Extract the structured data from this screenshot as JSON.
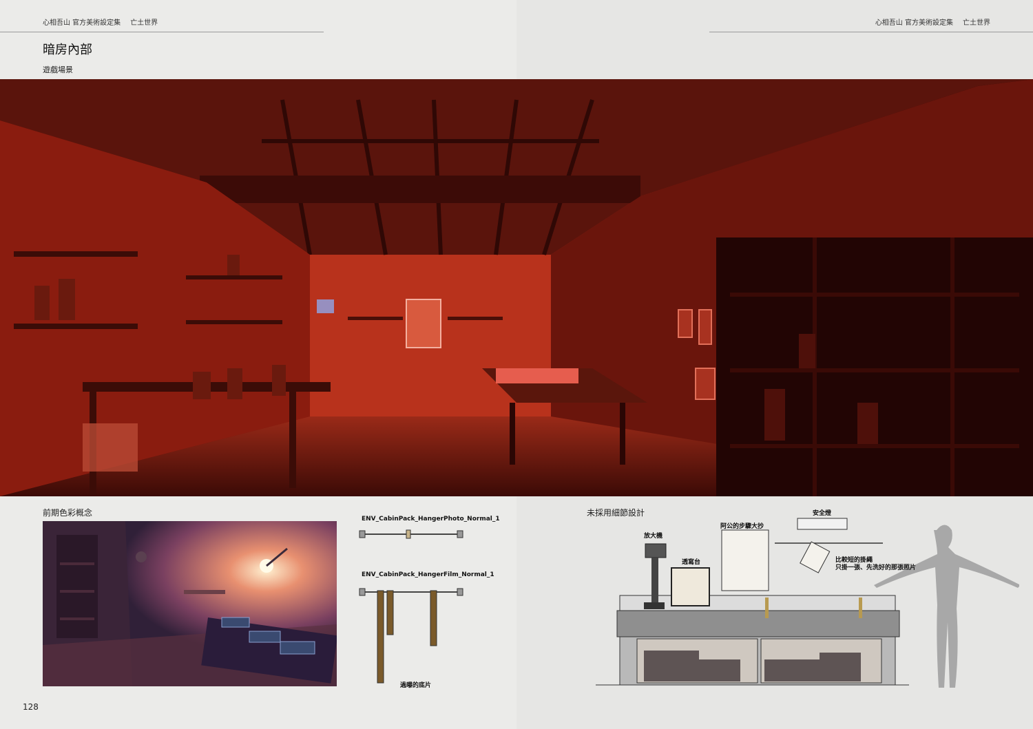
{
  "header_left": {
    "book": "心相吾山 官方美術設定集",
    "section": "亡土世界"
  },
  "header_right": {
    "book": "心相吾山 官方美術設定集",
    "section": "亡土世界"
  },
  "title": "暗房內部",
  "subtitle": "遊戲場景",
  "captions": {
    "concept": "前期色彩概念",
    "unused": "未採用細節設計"
  },
  "hanger_labels": {
    "photo": "ENV_CabinPack_HangerPhoto_Normal_1",
    "film": "ENV_CabinPack_HangerFilm_Normal_1",
    "film_note": "過曝的底片"
  },
  "detail_labels": {
    "enlarger": "放大機",
    "lightbox": "透寫台",
    "notes": "阿公的步驟大抄",
    "safelight": "安全燈",
    "hanger_note_1": "比較短的掛繩",
    "hanger_note_2": "只掛一張、先洗好的那張照片"
  },
  "page_number": "128",
  "colors": {
    "darkroom_red": "#c42a17",
    "safelight_glow": "#ff4a3a",
    "concept_purple": "#5a3c6a"
  }
}
